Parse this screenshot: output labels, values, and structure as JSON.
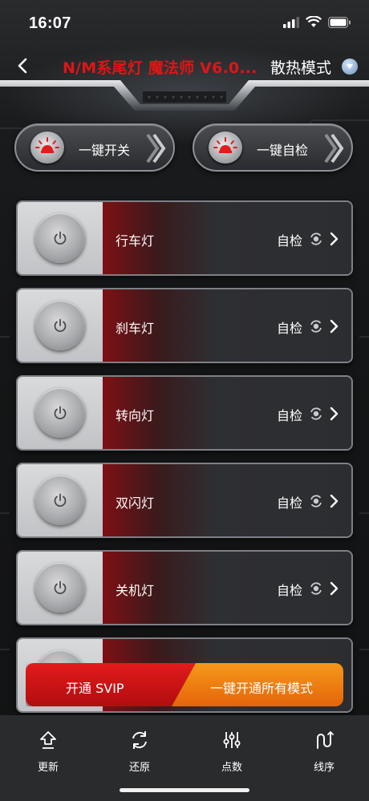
{
  "status": {
    "time": "16:07"
  },
  "header": {
    "title": "N/M系尾灯 魔法师 V6.0...",
    "mode_label": "散热模式",
    "accent": "#e01515"
  },
  "quick_actions": [
    {
      "label": "一键开关",
      "icon": "red-light-icon"
    },
    {
      "label": "一键自检",
      "icon": "red-light-icon"
    }
  ],
  "rows": [
    {
      "name": "行车灯",
      "check": "自检"
    },
    {
      "name": "刹车灯",
      "check": "自检"
    },
    {
      "name": "转向灯",
      "check": "自检"
    },
    {
      "name": "双闪灯",
      "check": "自检"
    },
    {
      "name": "关机灯",
      "check": "自检"
    }
  ],
  "promo": {
    "svip": "开通 SVIP",
    "all_modes": "一键开通所有模式",
    "svip_color": "#d81313",
    "all_color": "#ef7d12"
  },
  "tabs": [
    {
      "label": "更新",
      "icon": "upload-icon"
    },
    {
      "label": "还原",
      "icon": "refresh-icon"
    },
    {
      "label": "点数",
      "icon": "sliders-icon"
    },
    {
      "label": "线序",
      "icon": "wire-order-icon"
    }
  ]
}
